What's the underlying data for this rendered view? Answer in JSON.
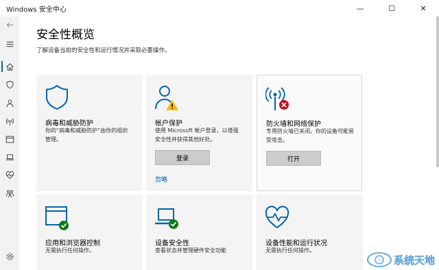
{
  "window": {
    "title": "Windows 安全中心",
    "minimize": "—",
    "maximize": "☐",
    "close": "✕"
  },
  "sidebar": {
    "items": [
      {
        "icon": "back-arrow-icon"
      },
      {
        "icon": "hamburger-icon"
      },
      {
        "icon": "home-icon"
      },
      {
        "icon": "shield-icon"
      },
      {
        "icon": "person-icon"
      },
      {
        "icon": "wireless-icon"
      },
      {
        "icon": "browser-window-icon"
      },
      {
        "icon": "laptop-icon"
      },
      {
        "icon": "heart-icon"
      },
      {
        "icon": "family-icon"
      },
      {
        "icon": "gear-icon"
      }
    ]
  },
  "main": {
    "title": "安全性概览",
    "subtitle": "了解设备当前的安全性和运行情况并采取必要操作。",
    "tiles": [
      {
        "title": "病毒和威胁防护",
        "desc": "你的“病毒和威胁防护”由你的组织管理。",
        "icon": "shield-icon"
      },
      {
        "title": "帐户保护",
        "desc": "使用 Microsoft 帐户登录，以增强安全性并获得其他好处。",
        "button": "登录",
        "link": "忽略",
        "icon": "person-warning-icon"
      },
      {
        "title": "防火墙和网络保护",
        "desc": "专用防火墙已关闭。你的设备可能易受攻击。",
        "button": "打开",
        "icon": "wireless-error-icon"
      },
      {
        "title": "应用和浏览器控制",
        "desc": "无需执行任何操作。",
        "icon": "browser-check-icon"
      },
      {
        "title": "设备安全性",
        "desc": "查看状态并管理硬件安全功能",
        "icon": "laptop-check-icon"
      },
      {
        "title": "设备性能和运行状况",
        "desc": "无需执行任何操作。",
        "icon": "heart-pulse-icon"
      }
    ]
  },
  "watermark": {
    "text": "系统天地"
  },
  "colors": {
    "accent": "#0063b1",
    "ok": "#107c10",
    "error": "#c50f1f",
    "warning": "#ffb900"
  }
}
